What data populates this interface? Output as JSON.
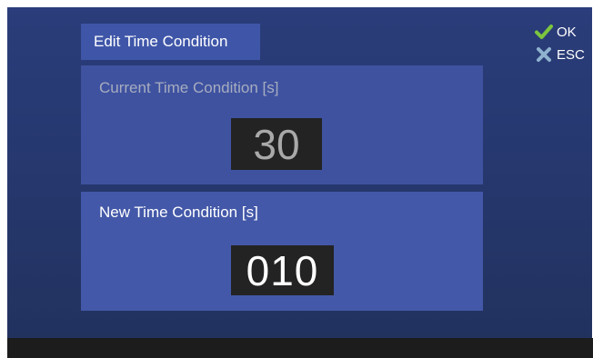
{
  "dialog": {
    "title": "Edit Time Condition"
  },
  "current": {
    "label": "Current Time Condition [s]",
    "value": "30"
  },
  "new": {
    "label": "New Time Condition [s]",
    "value": "010"
  },
  "actions": {
    "ok_label": "OK",
    "esc_label": "ESC",
    "ok_icon": "check-icon",
    "esc_icon": "cross-icon",
    "ok_color": "#7cc63e",
    "esc_color": "#8fb3cf"
  },
  "colors": {
    "background": "#26386f",
    "panel": "#4256a6",
    "value_box": "#232323",
    "bottom_bar": "#1c1c1c"
  }
}
